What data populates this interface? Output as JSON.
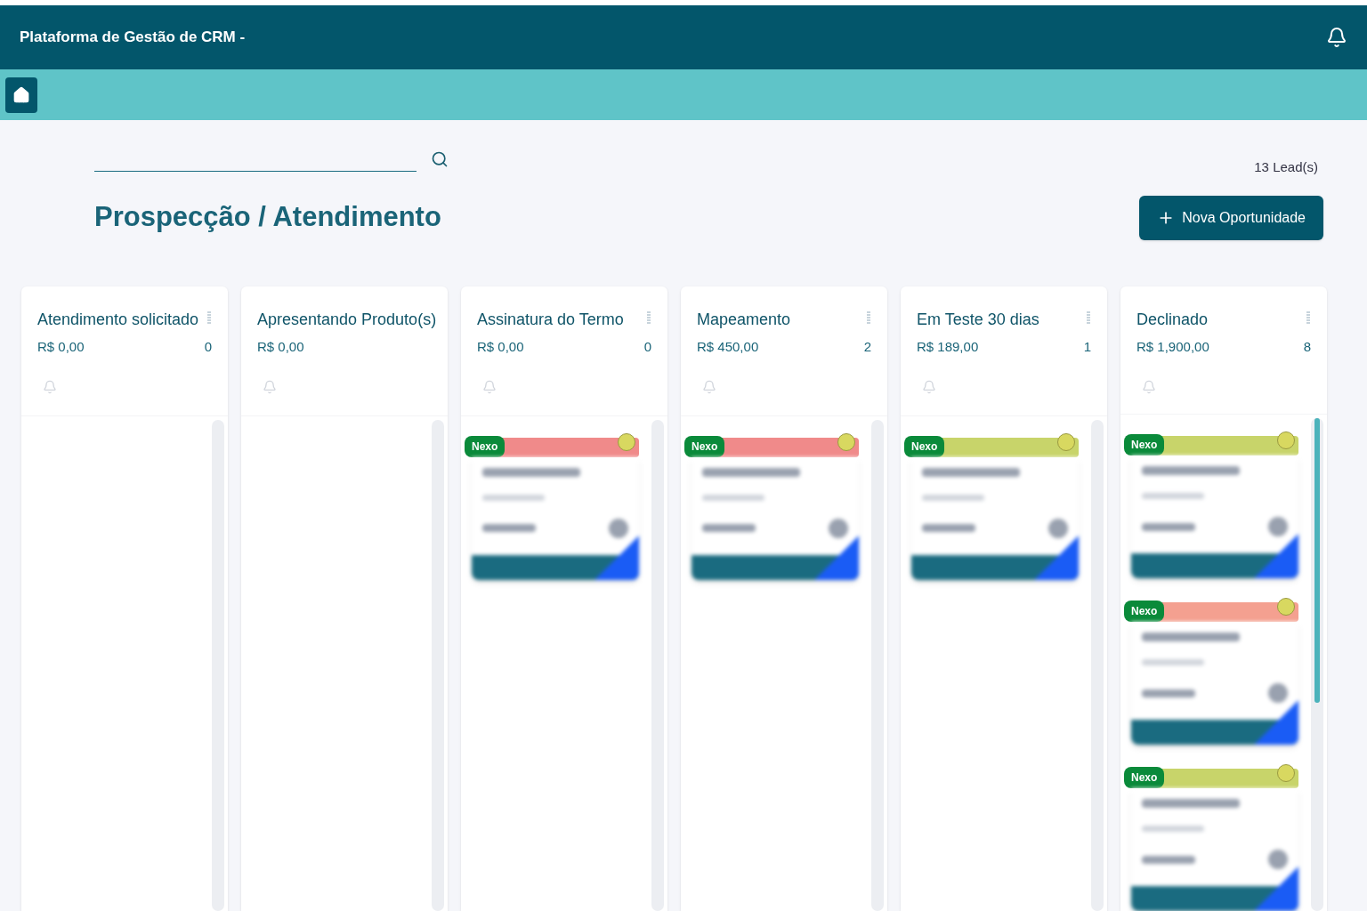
{
  "header": {
    "title": "Plataforma de Gestão de CRM -"
  },
  "leads_count": "13 Lead(s)",
  "page_title": "Prospecção / Atendimento",
  "new_button": "Nova Oportunidade",
  "columns": [
    {
      "title": "Atendimento solicitado",
      "total": "R$ 0,00",
      "count": "0"
    },
    {
      "title": "Apresentando Produto(s)",
      "total": "R$ 0,00"
    },
    {
      "title": "Assinatura do Termo",
      "total": "R$ 0,00",
      "count": "0",
      "cards": [
        {
          "badge": "Nexo",
          "color": "#f08a8a"
        }
      ]
    },
    {
      "title": "Mapeamento",
      "total": "R$ 450,00",
      "count": "2",
      "cards": [
        {
          "badge": "Nexo",
          "color": "#f08a8a"
        }
      ]
    },
    {
      "title": "Em Teste 30 dias",
      "total": "R$ 189,00",
      "count": "1",
      "cards": [
        {
          "badge": "Nexo",
          "color": "#c8d46a"
        }
      ]
    },
    {
      "title": "Declinado",
      "total": "R$ 1,900,00",
      "count": "8",
      "scroll": true,
      "cards": [
        {
          "badge": "Nexo",
          "color": "#c8d46a"
        },
        {
          "badge": "Nexo",
          "color": "#f4a090"
        },
        {
          "badge": "Nexo",
          "color": "#c8d46a"
        }
      ]
    }
  ]
}
